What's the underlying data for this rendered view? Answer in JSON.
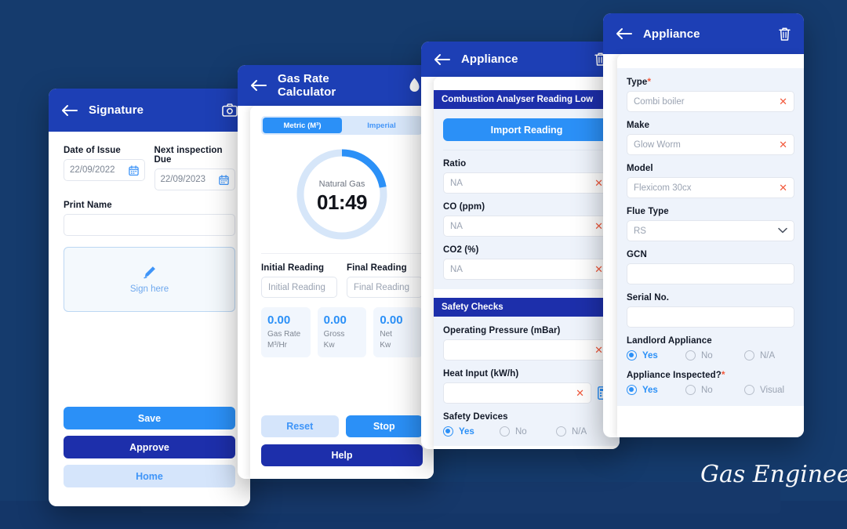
{
  "background": {
    "color": "#153b6d",
    "brand_blue": "#1d3fb5",
    "accent_blue": "#2b90f7",
    "navy": "#1d2fab",
    "danger": "#f2593c"
  },
  "watermark": {
    "text": "Gas Engineer S"
  },
  "signature_panel": {
    "header": {
      "title": "Signature",
      "back_icon": "arrow-left-icon",
      "camera_icon": "camera-icon"
    },
    "date_of_issue": {
      "label": "Date of Issue",
      "value": "22/09/2022",
      "icon": "calendar-icon"
    },
    "next_inspection_due": {
      "label": "Next inspection Due",
      "value": "22/09/2023",
      "icon": "calendar-icon"
    },
    "print_name": {
      "label": "Print Name",
      "value": ""
    },
    "sign_pad": {
      "text": "Sign here",
      "icon": "pen-icon"
    },
    "buttons": [
      {
        "label": "Save",
        "style": "blue"
      },
      {
        "label": "Approve",
        "style": "navy"
      },
      {
        "label": "Home",
        "style": "light"
      }
    ]
  },
  "gas_rate_panel": {
    "header": {
      "title": "Gas Rate Calculator",
      "back_icon": "arrow-left-icon",
      "flame_icon": "flame-icon"
    },
    "tabs": [
      {
        "label": "Metric (M³)",
        "active": true
      },
      {
        "label": "Imperial",
        "active": false
      }
    ],
    "gauge": {
      "caption": "Natural Gas",
      "time": "01:49",
      "progress_deg": 80,
      "track_color": "#d6e6f9",
      "arc_color": "#2b90f7"
    },
    "initial_reading": {
      "label": "Initial Reading",
      "placeholder": "Initial Reading",
      "value": ""
    },
    "final_reading": {
      "label": "Final Reading",
      "placeholder": "Final Reading",
      "value": ""
    },
    "results": [
      {
        "value": "0.00",
        "unit_line1": "Gas Rate",
        "unit_line2": "M³/Hr"
      },
      {
        "value": "0.00",
        "unit_line1": "Gross",
        "unit_line2": "Kw"
      },
      {
        "value": "0.00",
        "unit_line1": "Net",
        "unit_line2": "Kw"
      }
    ],
    "buttons": {
      "reset": "Reset",
      "stop": "Stop",
      "help": "Help"
    }
  },
  "appliance_combustion_panel": {
    "header": {
      "title": "Appliance",
      "back_icon": "arrow-left-icon",
      "delete_icon": "trash-icon"
    },
    "section_title": "Combustion Analyser Reading Low",
    "import_button": "Import Reading",
    "fields": [
      {
        "label": "Ratio",
        "value": "NA",
        "clear_icon": "close-icon"
      },
      {
        "label": "CO (ppm)",
        "value": "NA",
        "clear_icon": "close-icon"
      },
      {
        "label": "CO2 (%)",
        "value": "NA",
        "clear_icon": "close-icon"
      }
    ],
    "safety_section_title": "Safety Checks",
    "operating_pressure": {
      "label": "Operating Pressure (mBar)",
      "value": "",
      "clear_icon": "close-icon"
    },
    "heat_input": {
      "label": "Heat Input (kW/h)",
      "value": "",
      "clear_icon": "close-icon",
      "calculator_icon": "calculator-icon"
    },
    "safety_devices": {
      "label": "Safety Devices",
      "options": [
        {
          "label": "Yes",
          "selected": true
        },
        {
          "label": "No",
          "selected": false
        },
        {
          "label": "N/A",
          "selected": false
        }
      ]
    }
  },
  "appliance_details_panel": {
    "header": {
      "title": "Appliance",
      "back_icon": "arrow-left-icon",
      "delete_icon": "trash-icon"
    },
    "fields": [
      {
        "label": "Type",
        "required": true,
        "value": "Combi boiler",
        "trailing": "clear"
      },
      {
        "label": "Make",
        "required": false,
        "value": "Glow Worm",
        "trailing": "clear"
      },
      {
        "label": "Model",
        "required": false,
        "value": "Flexicom 30cx",
        "trailing": "clear"
      },
      {
        "label": "Flue Type",
        "required": false,
        "value": "RS",
        "trailing": "chevron"
      },
      {
        "label": "GCN",
        "required": false,
        "value": "",
        "trailing": "none"
      },
      {
        "label": "Serial No.",
        "required": false,
        "value": "",
        "trailing": "none"
      }
    ],
    "landlord_appliance": {
      "label": "Landlord Appliance",
      "options": [
        {
          "label": "Yes",
          "selected": true
        },
        {
          "label": "No",
          "selected": false
        },
        {
          "label": "N/A",
          "selected": false
        }
      ]
    },
    "appliance_inspected": {
      "label": "Appliance Inspected?",
      "required": true,
      "options": [
        {
          "label": "Yes",
          "selected": true
        },
        {
          "label": "No",
          "selected": false
        },
        {
          "label": "Visual",
          "selected": false
        }
      ]
    }
  }
}
